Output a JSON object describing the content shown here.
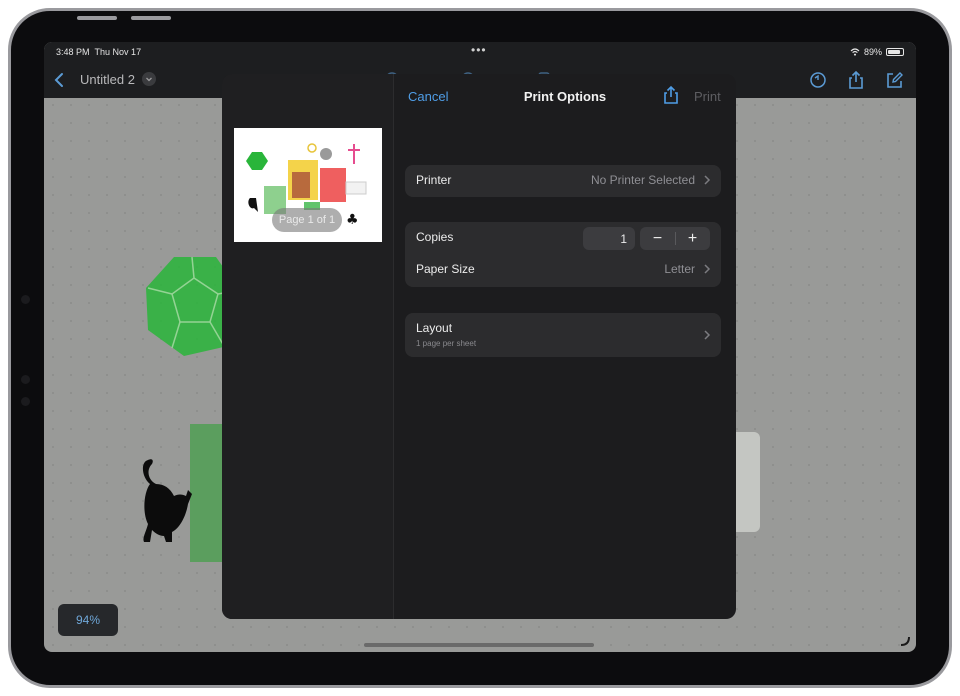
{
  "status_bar": {
    "time": "3:48 PM",
    "date": "Thu Nov 17",
    "battery": "89%"
  },
  "nav": {
    "title": "Untitled 2"
  },
  "canvas": {
    "zoom_label": "94%"
  },
  "print_sheet": {
    "cancel_label": "Cancel",
    "title": "Print Options",
    "print_label": "Print",
    "preview_page_label": "Page 1 of 1",
    "printer": {
      "label": "Printer",
      "value": "No Printer Selected"
    },
    "copies": {
      "label": "Copies",
      "value": "1",
      "decrement": "−",
      "increment": "+"
    },
    "paper_size": {
      "label": "Paper Size",
      "value": "Letter"
    },
    "layout": {
      "label": "Layout",
      "sublabel": "1 page per sheet"
    }
  },
  "colors": {
    "accent": "#4f9de6",
    "sheet_bg": "#1c1c1e",
    "row_bg": "#2c2c2e",
    "canvas_green": "#2fbf3a"
  }
}
